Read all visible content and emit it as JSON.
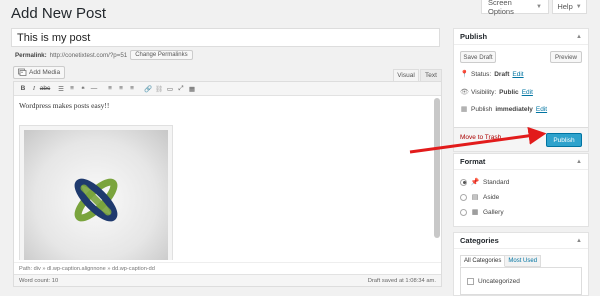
{
  "header": {
    "title": "Add New Post",
    "screen_options": "Screen Options",
    "help": "Help"
  },
  "editor": {
    "title_value": "This is my post",
    "permalink_label": "Permalink:",
    "permalink_url": "http://conetixtest.com/?p=51",
    "change_permalinks": "Change Permalinks",
    "add_media": "Add Media",
    "tab_visual": "Visual",
    "tab_text": "Text",
    "body_text": "Wordpress makes posts easy!!",
    "path": "Path: div » dl.wp-caption.alignnone » dd.wp-caption-dd",
    "word_count": "Word count: 10",
    "draft_saved": "Draft saved at 1:08:34 am."
  },
  "publish": {
    "title": "Publish",
    "save_draft": "Save Draft",
    "preview": "Preview",
    "status_label": "Status:",
    "status_value": "Draft",
    "visibility_label": "Visibility:",
    "visibility_value": "Public",
    "publish_label": "Publish",
    "publish_value": "immediately",
    "edit": "Edit",
    "move_to_trash": "Move to Trash",
    "publish_button": "Publish"
  },
  "format": {
    "title": "Format",
    "options": [
      "Standard",
      "Aside",
      "Gallery"
    ],
    "selected": "Standard"
  },
  "categories": {
    "title": "Categories",
    "tab_all": "All Categories",
    "tab_most_used": "Most Used",
    "items": [
      "Uncategorized"
    ]
  },
  "colors": {
    "publish_button": "#2ea2cc",
    "link": "#0074a2",
    "trash": "#a00",
    "arrow": "#e21b1b",
    "logo_green": "#7aa43d",
    "logo_navy": "#1f3a6e"
  }
}
